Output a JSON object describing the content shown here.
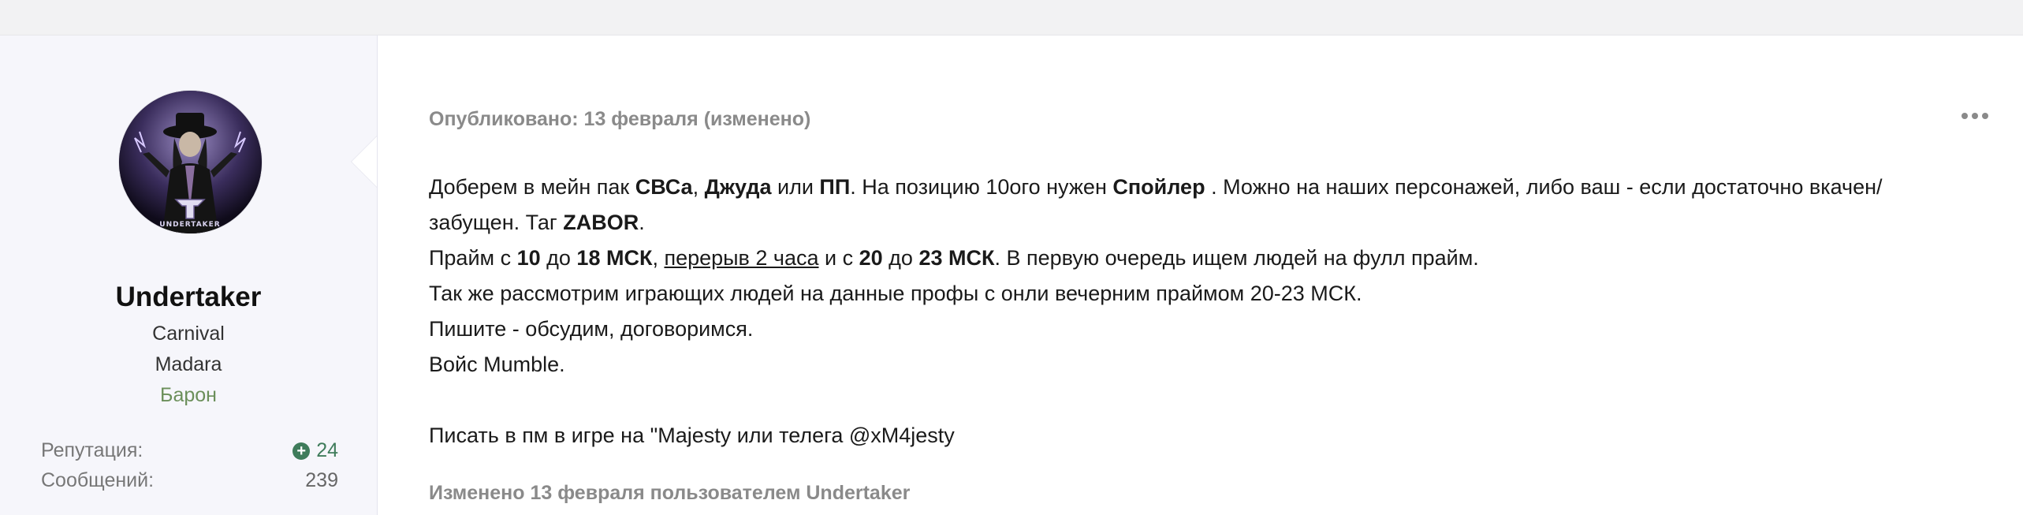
{
  "author": {
    "name": "Undertaker",
    "server": "Carnival",
    "clan": "Madara",
    "rank": "Барон",
    "reputation_label": "Репутация:",
    "reputation_value": "24",
    "posts_label": "Сообщений:",
    "posts_value": "239",
    "avatar_caption": "UNDERTAKER"
  },
  "post": {
    "published": "Опубликовано: 13 февраля (изменено)",
    "line1": {
      "t1": "Доберем в мейн пак ",
      "b1": "СВСа",
      "t2": ", ",
      "b2": "Джуда",
      "t3": " или ",
      "b3": "ПП",
      "t4": ". На позицию 10ого нужен ",
      "b4": "Спойлер",
      "t5": " .  Можно на наших персонажей, либо ваш - если достаточно вкачен/ забущен. Таг ",
      "b5": "ZABOR",
      "t6": "."
    },
    "line2": {
      "t1": "Прайм с ",
      "b1": "10",
      "t2": " до ",
      "b2": "18 МСК",
      "t3": ", ",
      "u1": "перерыв 2 часа",
      "t4": " и с ",
      "b3": "20",
      "t5": " до ",
      "b4": "23 МСК",
      "t6": ". В первую очередь ищем людей на фулл прайм."
    },
    "line3": "Так же рассмотрим играющих людей на данные профы с онли вечерним праймом 20-23 МСК.",
    "line4": "Пишите - обсудим, договоримся.",
    "line5": "Войс Mumble.",
    "line6": "Писать в пм в игре на \"Majesty или телега @xM4jesty",
    "edited": "Изменено 13 февраля пользователем Undertaker"
  },
  "colors": {
    "rank": "#6b8f5a",
    "reputation": "#3f7c5b",
    "meta": "#8a8a8a",
    "author_bg": "#f6f6fb"
  },
  "icons": {
    "menu": "more-horizontal-icon",
    "reputation": "plus-circle-icon"
  }
}
